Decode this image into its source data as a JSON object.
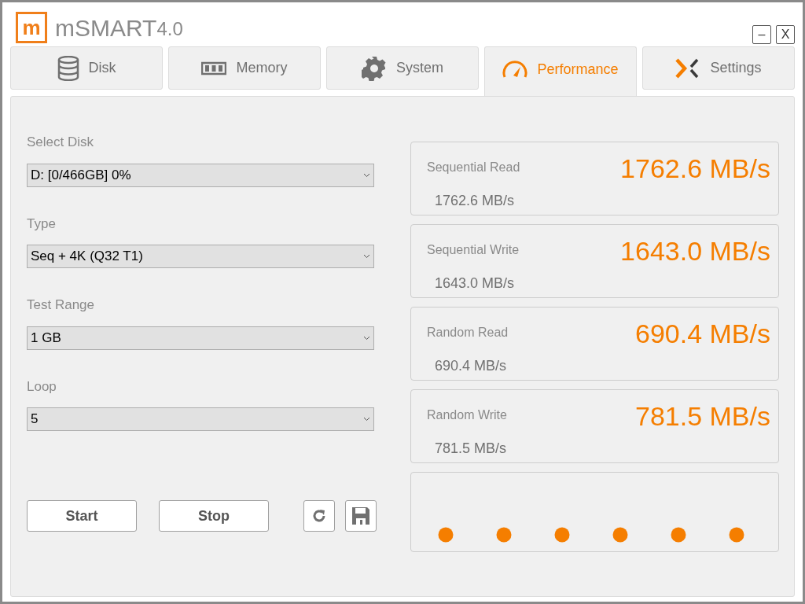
{
  "window": {
    "logo": "m",
    "title": "mSMART",
    "version": "4.0",
    "controls": [
      "–",
      "X"
    ]
  },
  "tabs": [
    {
      "label": "Disk",
      "kind": "disk",
      "selected": false
    },
    {
      "label": "Memory",
      "kind": "memory",
      "selected": false
    },
    {
      "label": "System",
      "kind": "gear",
      "selected": false
    },
    {
      "label": "Performance",
      "kind": "gauge",
      "selected": true
    },
    {
      "label": "Settings",
      "kind": "x",
      "selected": false
    }
  ],
  "fields": [
    {
      "label": "Select Disk",
      "value": "D: [0/466GB] 0%"
    },
    {
      "label": "Type",
      "value": "Seq + 4K (Q32 T1)"
    },
    {
      "label": "Test Range",
      "value": "1 GB"
    },
    {
      "label": "Loop",
      "value": "5"
    }
  ],
  "buttons": [
    "Start",
    "Stop"
  ],
  "results": [
    {
      "label": "Sequential Read",
      "big": "1762.6 MB/s",
      "small": "1762.6 MB/s"
    },
    {
      "label": "Sequential Write",
      "big": "1643.0 MB/s",
      "small": "1643.0 MB/s"
    },
    {
      "label": "Random Read",
      "big": "690.4 MB/s",
      "small": "690.4 MB/s"
    },
    {
      "label": "Random Write",
      "big": "781.5 MB/s",
      "small": "781.5 MB/s"
    }
  ]
}
